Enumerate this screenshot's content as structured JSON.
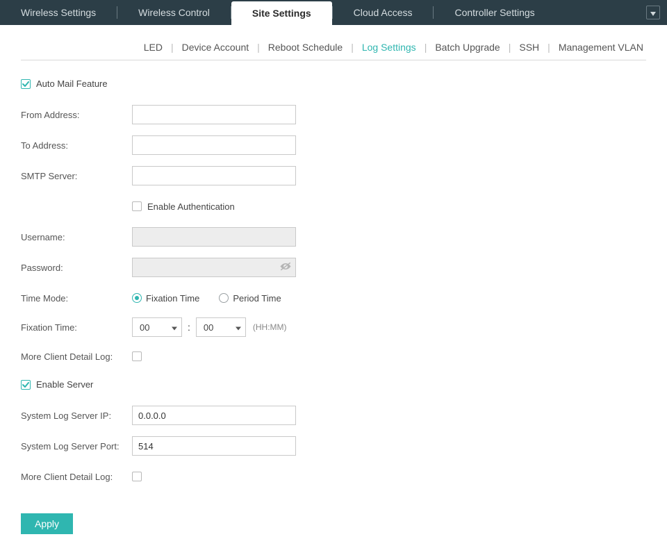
{
  "topnav": {
    "tabs": [
      {
        "label": "Wireless Settings"
      },
      {
        "label": "Wireless Control"
      },
      {
        "label": "Site Settings",
        "active": true
      },
      {
        "label": "Cloud Access"
      },
      {
        "label": "Controller Settings"
      }
    ]
  },
  "subnav": {
    "items": [
      {
        "label": "LED"
      },
      {
        "label": "Device Account"
      },
      {
        "label": "Reboot Schedule"
      },
      {
        "label": "Log Settings",
        "active": true
      },
      {
        "label": "Batch Upgrade"
      },
      {
        "label": "SSH"
      },
      {
        "label": "Management VLAN"
      }
    ]
  },
  "form": {
    "autoMail": {
      "label": "Auto Mail Feature",
      "checked": true
    },
    "fromAddress": {
      "label": "From Address:",
      "value": ""
    },
    "toAddress": {
      "label": "To Address:",
      "value": ""
    },
    "smtpServer": {
      "label": "SMTP Server:",
      "value": ""
    },
    "enableAuth": {
      "label": "Enable Authentication",
      "checked": false
    },
    "username": {
      "label": "Username:",
      "value": ""
    },
    "password": {
      "label": "Password:",
      "value": ""
    },
    "timeMode": {
      "label": "Time Mode:",
      "options": {
        "fixation": "Fixation Time",
        "period": "Period Time"
      },
      "value": "fixation"
    },
    "fixationTime": {
      "label": "Fixation Time:",
      "hour": "00",
      "minute": "00",
      "hint": "(HH:MM)"
    },
    "moreClientDetail1": {
      "label": "More Client Detail Log:",
      "checked": false
    },
    "enableServer": {
      "label": "Enable Server",
      "checked": true
    },
    "serverIp": {
      "label": "System Log Server IP:",
      "value": "0.0.0.0"
    },
    "serverPort": {
      "label": "System Log Server Port:",
      "value": "514"
    },
    "moreClientDetail2": {
      "label": "More Client Detail Log:",
      "checked": false
    },
    "applyLabel": "Apply",
    "timeSep": ":"
  }
}
